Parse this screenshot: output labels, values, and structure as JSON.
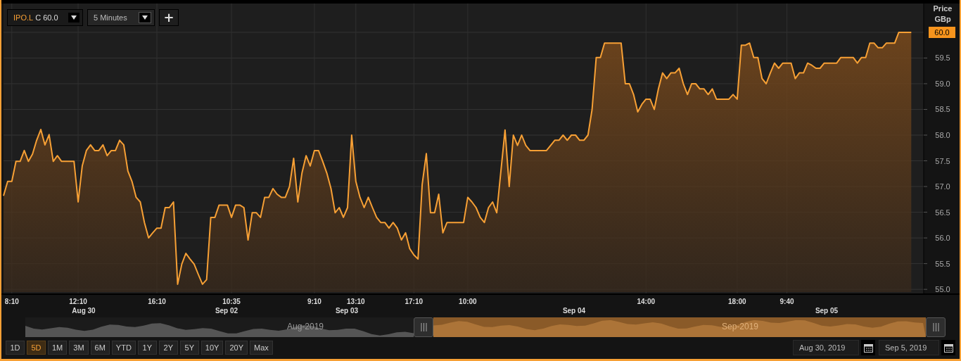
{
  "toolbar": {
    "symbol": "IPO.L",
    "quote": "C 60.0",
    "interval": "5 Minutes",
    "add_button": "+"
  },
  "price_axis": {
    "title": "Price",
    "unit": "GBp",
    "current": "60.0"
  },
  "chart_data": {
    "type": "area",
    "grid": true,
    "ylim": [
      54.92,
      60.56
    ],
    "categories": [
      null,
      null,
      "8:10",
      null,
      null,
      null,
      null,
      null,
      null,
      null,
      null,
      null,
      null,
      null,
      null,
      null,
      null,
      null,
      "12:10",
      null,
      null,
      null,
      null,
      null,
      null,
      null,
      null,
      null,
      null,
      null,
      null,
      null,
      null,
      null,
      null,
      null,
      null,
      "16:10",
      null,
      null,
      null,
      null,
      null,
      null,
      null,
      null,
      null,
      null,
      null,
      null,
      null,
      null,
      null,
      null,
      null,
      "10:35",
      null,
      null,
      null,
      null,
      null,
      null,
      null,
      null,
      null,
      null,
      null,
      null,
      null,
      null,
      null,
      null,
      null,
      null,
      null,
      "9:10",
      null,
      null,
      null,
      null,
      null,
      null,
      null,
      null,
      null,
      "13:10",
      null,
      null,
      null,
      null,
      null,
      null,
      null,
      null,
      null,
      null,
      null,
      null,
      null,
      "17:10",
      null,
      null,
      null,
      null,
      null,
      null,
      null,
      null,
      null,
      null,
      null,
      null,
      "10:00",
      null,
      null,
      null,
      null,
      null,
      null,
      null,
      null,
      null,
      null,
      null,
      null,
      null,
      null,
      null,
      null,
      null,
      null,
      null,
      null,
      null,
      null,
      null,
      null,
      null,
      null,
      null,
      null,
      null,
      null,
      null,
      null,
      null,
      null,
      null,
      null,
      null,
      null,
      null,
      null,
      null,
      null,
      "14:00",
      null,
      null,
      null,
      null,
      null,
      null,
      null,
      null,
      null,
      null,
      null,
      null,
      null,
      null,
      null,
      null,
      null,
      null,
      null,
      null,
      null,
      "18:00",
      null,
      null,
      null,
      null,
      null,
      null,
      null,
      null,
      null,
      null,
      null,
      "9:40",
      null,
      null,
      null,
      null,
      null,
      null,
      null,
      null,
      null,
      null,
      null,
      null,
      null,
      null,
      null,
      null,
      null,
      null,
      null,
      null,
      null,
      null,
      null,
      null,
      null,
      null,
      null,
      null,
      null,
      null
    ],
    "values": [
      56.82,
      57.1,
      57.1,
      57.49,
      57.49,
      57.7,
      57.49,
      57.63,
      57.9,
      58.11,
      57.81,
      58.01,
      57.49,
      57.6,
      57.49,
      57.49,
      57.49,
      57.49,
      56.7,
      57.4,
      57.7,
      57.81,
      57.7,
      57.7,
      57.81,
      57.6,
      57.7,
      57.7,
      57.9,
      57.81,
      57.3,
      57.1,
      56.79,
      56.7,
      56.3,
      56.0,
      56.1,
      56.19,
      56.19,
      56.59,
      56.59,
      56.7,
      55.1,
      55.49,
      55.7,
      55.59,
      55.49,
      55.29,
      55.1,
      55.19,
      56.4,
      56.4,
      56.64,
      56.64,
      56.64,
      56.4,
      56.64,
      56.64,
      56.59,
      55.96,
      56.49,
      56.49,
      56.4,
      56.79,
      56.79,
      56.96,
      56.85,
      56.79,
      56.79,
      57.0,
      57.55,
      56.7,
      57.26,
      57.6,
      57.4,
      57.7,
      57.7,
      57.49,
      57.26,
      56.96,
      56.49,
      56.59,
      56.4,
      56.59,
      58.0,
      57.1,
      56.79,
      56.59,
      56.79,
      56.59,
      56.4,
      56.3,
      56.3,
      56.19,
      56.3,
      56.19,
      55.96,
      56.1,
      55.79,
      55.67,
      55.59,
      57.04,
      57.64,
      56.49,
      56.49,
      56.85,
      56.1,
      56.3,
      56.3,
      56.3,
      56.3,
      56.3,
      56.79,
      56.7,
      56.59,
      56.4,
      56.3,
      56.59,
      56.7,
      56.49,
      57.3,
      58.1,
      57.0,
      58.0,
      57.8,
      58.0,
      57.8,
      57.7,
      57.7,
      57.7,
      57.7,
      57.7,
      57.8,
      57.9,
      57.9,
      58.0,
      57.9,
      58.0,
      58.0,
      57.9,
      57.9,
      58.0,
      58.5,
      59.51,
      59.51,
      59.79,
      59.79,
      59.79,
      59.79,
      59.79,
      59.0,
      59.0,
      58.79,
      58.45,
      58.6,
      58.7,
      58.7,
      58.5,
      58.9,
      59.21,
      59.1,
      59.21,
      59.21,
      59.3,
      59.0,
      58.79,
      59.0,
      59.0,
      58.9,
      58.9,
      58.79,
      58.9,
      58.7,
      58.7,
      58.7,
      58.7,
      58.79,
      58.7,
      59.75,
      59.75,
      59.79,
      59.51,
      59.51,
      59.1,
      59.0,
      59.21,
      59.4,
      59.3,
      59.4,
      59.4,
      59.4,
      59.1,
      59.21,
      59.21,
      59.4,
      59.36,
      59.3,
      59.3,
      59.4,
      59.4,
      59.4,
      59.4,
      59.51,
      59.51,
      59.51,
      59.51,
      59.4,
      59.51,
      59.51,
      59.79,
      59.79,
      59.7,
      59.7,
      59.79,
      59.79,
      59.79,
      60.0,
      60.0,
      60.0,
      60.0
    ],
    "yticks": [
      {
        "value": 55,
        "label": "55.0"
      },
      {
        "value": 55.5,
        "label": "55.5"
      },
      {
        "value": 56,
        "label": "56.0"
      },
      {
        "value": 56.5,
        "label": "56.5"
      },
      {
        "value": 57,
        "label": "57.0"
      },
      {
        "value": 57.5,
        "label": "57.5"
      },
      {
        "value": 58,
        "label": "58.0"
      },
      {
        "value": 58.5,
        "label": "58.5"
      },
      {
        "value": 59,
        "label": "59.0"
      },
      {
        "value": 59.5,
        "label": "59.5"
      }
    ]
  },
  "date_axis": [
    {
      "label": "Aug 30"
    },
    {
      "label": "Sep 02"
    },
    {
      "label": "Sep 03"
    },
    {
      "label": "Sep 04"
    },
    {
      "label": "Sep 05"
    }
  ],
  "navigator": {
    "ranges": [
      {
        "label": "Aug-2019",
        "selected": false
      },
      {
        "label": "Sep-2019",
        "selected": true
      }
    ]
  },
  "range_buttons": [
    {
      "label": "1D",
      "selected": false
    },
    {
      "label": "5D",
      "selected": true
    },
    {
      "label": "1M",
      "selected": false
    },
    {
      "label": "3M",
      "selected": false
    },
    {
      "label": "6M",
      "selected": false
    },
    {
      "label": "YTD",
      "selected": false
    },
    {
      "label": "1Y",
      "selected": false
    },
    {
      "label": "2Y",
      "selected": false
    },
    {
      "label": "5Y",
      "selected": false
    },
    {
      "label": "10Y",
      "selected": false
    },
    {
      "label": "20Y",
      "selected": false
    },
    {
      "label": "Max",
      "selected": false
    }
  ],
  "date_range": {
    "from": "Aug 30, 2019",
    "to": "Sep 5, 2019"
  }
}
